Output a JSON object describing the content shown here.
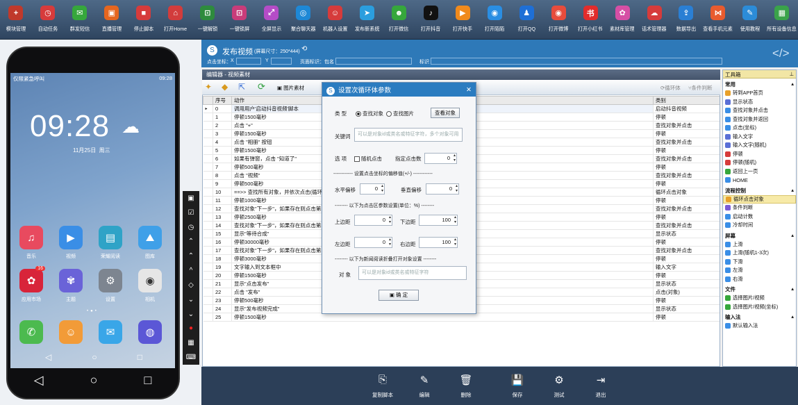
{
  "toolbar": {
    "items": [
      {
        "label": "模块管理",
        "icon": "+",
        "color": "#c0392b"
      },
      {
        "label": "自动任务",
        "icon": "◷",
        "color": "#d63b3b"
      },
      {
        "label": "群发短信",
        "icon": "✉",
        "color": "#36a73c"
      },
      {
        "label": "直播管理",
        "icon": "▣",
        "color": "#e5661f"
      },
      {
        "label": "停止脚本",
        "icon": "■",
        "color": "#d63b3b"
      },
      {
        "label": "打开Home",
        "icon": "⌂",
        "color": "#d23c3c"
      },
      {
        "label": "一键解锁",
        "icon": "⊡",
        "color": "#2e8b3d"
      },
      {
        "label": "一键锁屏",
        "icon": "⊡",
        "color": "#c93c7a"
      },
      {
        "label": "全屏显示",
        "icon": "⤢",
        "color": "#b44cc7"
      },
      {
        "label": "聚合聊天器",
        "icon": "◎",
        "color": "#1e88d6"
      },
      {
        "label": "机器人设置",
        "icon": "☺",
        "color": "#d63b3b"
      },
      {
        "label": "发布新系统",
        "icon": "➤",
        "color": "#2b9ede"
      },
      {
        "label": "打开微信",
        "icon": "☻",
        "color": "#36a73c"
      },
      {
        "label": "打开抖音",
        "icon": "♪",
        "color": "#111111"
      },
      {
        "label": "打开快手",
        "icon": "▶",
        "color": "#f08a1c"
      },
      {
        "label": "打开陌陌",
        "icon": "◉",
        "color": "#2a8ee3"
      },
      {
        "label": "打开QQ",
        "icon": "♟",
        "color": "#1e6fd6"
      },
      {
        "label": "打开微博",
        "icon": "◉",
        "color": "#e74c3c"
      },
      {
        "label": "打开小红书",
        "icon": "书",
        "color": "#e22c2c"
      },
      {
        "label": "素材库管理",
        "icon": "✿",
        "color": "#d64fa5"
      },
      {
        "label": "话术管理器",
        "icon": "☁",
        "color": "#d63b3b"
      },
      {
        "label": "数据导出",
        "icon": "⇪",
        "color": "#2a7fd4"
      },
      {
        "label": "查看手机元素",
        "icon": "⋈",
        "color": "#e85b2e"
      },
      {
        "label": "使用教程",
        "icon": "✎",
        "color": "#2c8cd8"
      },
      {
        "label": "所有设备信息",
        "icon": "▦",
        "color": "#3aa34a"
      }
    ]
  },
  "phone": {
    "status_left": "仅限紧急呼叫",
    "status_right": "09:28",
    "clock": "09:28",
    "date": "11月25日",
    "weekday": "周三",
    "apps_row1": [
      {
        "label": "音乐",
        "icon": "♫",
        "color": "#e84a5f"
      },
      {
        "label": "视频",
        "icon": "▶",
        "color": "#3a8ee6"
      },
      {
        "label": "荣耀阅读",
        "icon": "▤",
        "color": "#2fa3c7"
      },
      {
        "label": "图库",
        "icon": "⛰",
        "color": "#3fa0e8"
      }
    ],
    "apps_row2": [
      {
        "label": "应用市场",
        "icon": "✿",
        "color": "#d8243a",
        "badge": "16"
      },
      {
        "label": "主题",
        "icon": "✾",
        "color": "#6a63d8"
      },
      {
        "label": "设置",
        "icon": "⚙",
        "color": "#7d8590"
      },
      {
        "label": "相机",
        "icon": "◉",
        "color": "#e6e6e6"
      }
    ],
    "dock": [
      {
        "icon": "✆",
        "color": "#4cba4f"
      },
      {
        "icon": "☺",
        "color": "#f29b38"
      },
      {
        "icon": "✉",
        "color": "#39a6e8"
      },
      {
        "icon": "◍",
        "color": "#5b57d6"
      }
    ]
  },
  "window": {
    "title": "发布视频",
    "title_hint": "(屏幕尺寸：250*444)",
    "coord_label": "点击坐标：",
    "x_label": "X",
    "y_label": "Y",
    "page_label": "页面标识：包名",
    "mark_label": "标识",
    "editor_title": "编辑器 - 视频素材",
    "img_material": "图片素材",
    "loop_label": "循环体",
    "cond_label": "条件判断",
    "col_seq": "序号",
    "col_action": "动作",
    "col_type": "类别"
  },
  "rows": [
    {
      "n": "0",
      "a": "调用用户'启动抖音视频'脚本",
      "t": "启动抖音视频"
    },
    {
      "n": "1",
      "a": "停顿1500毫秒",
      "t": "停顿"
    },
    {
      "n": "2",
      "a": "点击 \"+\"",
      "t": "查找对象并点击"
    },
    {
      "n": "3",
      "a": "停顿1500毫秒",
      "t": "停顿"
    },
    {
      "n": "4",
      "a": "点击 \"相册\" 按钮",
      "t": "查找对象并点击"
    },
    {
      "n": "5",
      "a": "停顿1500毫秒",
      "t": "停顿"
    },
    {
      "n": "6",
      "a": "如果有弹窗，点击 \"知道了\"",
      "t": "查找对象并点击"
    },
    {
      "n": "7",
      "a": "停顿500毫秒",
      "t": "停顿"
    },
    {
      "n": "8",
      "a": "点击 \"视频\"",
      "t": "查找对象并点击"
    },
    {
      "n": "9",
      "a": "停顿500毫秒",
      "t": "停顿"
    },
    {
      "n": "10",
      "a": "==>> 查找所有对象，并依次点击(循环)",
      "t": "循环点击对象"
    },
    {
      "n": "11",
      "a": "停顿1000毫秒",
      "t": "停顿"
    },
    {
      "n": "12",
      "a": "查找对象\"下一步\"，如果存在则点击第1个",
      "t": "查找对象并点击"
    },
    {
      "n": "13",
      "a": "停顿2500毫秒",
      "t": "停顿"
    },
    {
      "n": "14",
      "a": "查找对象\"下一步\"，如果存在则点击第1个",
      "t": "查找对象并点击"
    },
    {
      "n": "15",
      "a": "显示\"等待合成\"",
      "t": "显示状态"
    },
    {
      "n": "16",
      "a": "停顿30000毫秒",
      "t": "停顿"
    },
    {
      "n": "17",
      "a": "查找对象\"下一步\"，如果存在则点击第1个",
      "t": "查找对象并点击"
    },
    {
      "n": "18",
      "a": "停顿3000毫秒",
      "t": "停顿"
    },
    {
      "n": "19",
      "a": "文字输入到文本框中",
      "t": "输入文字"
    },
    {
      "n": "20",
      "a": "停顿1500毫秒",
      "t": "停顿"
    },
    {
      "n": "21",
      "a": "显示\"点击发布\"",
      "t": "显示状态"
    },
    {
      "n": "22",
      "a": "点击 \"发布\"",
      "t": "点击(对象)"
    },
    {
      "n": "23",
      "a": "停顿500毫秒",
      "t": "停顿"
    },
    {
      "n": "24",
      "a": "显示\"发布视频完成\"",
      "t": "显示状态"
    },
    {
      "n": "25",
      "a": "停顿1500毫秒",
      "t": "停顿"
    }
  ],
  "dialog": {
    "title": "设置次循环体参数",
    "type_label": "类  型",
    "opt_find_object": "查找对象",
    "opt_find_image": "查找图片",
    "view_object_btn": "查看对象",
    "keyword_label": "关键词",
    "keyword_placeholder": "可以是对象id或类名或特征字符，多个对象可用",
    "options_label": "选  项",
    "random_click": "随机点击",
    "click_count_label": "指定点击数",
    "click_count": "0",
    "offset_caption": "------------ 设置点击坐标的偏移值(+/-) ------------",
    "h_offset_label": "水平偏移",
    "h_offset": "0",
    "v_offset_label": "垂直偏移",
    "v_offset": "0",
    "margin_caption": "-------- 以下为点击区参数设置(单位：%) --------",
    "top_label": "上边距",
    "top": "0",
    "bottom_label": "下边距",
    "bottom": "100",
    "left_label": "左边距",
    "left": "0",
    "right_label": "右边距",
    "right": "100",
    "fold_caption": "-------- 以下为新闻阅读折叠打开对象设置 --------",
    "object_label": "对  象",
    "object_placeholder": "可以是对象id或类名或特征字符",
    "ok_btn": "确  定"
  },
  "toolbox": {
    "title": "工具箱",
    "sections": [
      {
        "name": "常用",
        "items": [
          {
            "label": "转到APP首页",
            "color": "#e8a02a"
          },
          {
            "label": "显示状态",
            "color": "#5a6fd6"
          },
          {
            "label": "查找对象并点击",
            "color": "#3a8ee6"
          },
          {
            "label": "查找对象并返回",
            "color": "#3a8ee6"
          },
          {
            "label": "点击(坐标)",
            "color": "#3a8ee6"
          },
          {
            "label": "输入文字",
            "color": "#5a6fd6"
          },
          {
            "label": "输入文字(随机)",
            "color": "#5a6fd6"
          },
          {
            "label": "停顿",
            "color": "#d63b3b"
          },
          {
            "label": "停顿(随机)",
            "color": "#d63b3b"
          },
          {
            "label": "返回上一页",
            "color": "#36a73c"
          },
          {
            "label": "HOME",
            "color": "#3a8ee6"
          }
        ]
      },
      {
        "name": "流程控制",
        "items": [
          {
            "label": "循环点击对象",
            "color": "#e8a02a",
            "hl": true
          },
          {
            "label": "条件判断",
            "color": "#7a5bd6"
          },
          {
            "label": "启动计数",
            "color": "#3a8ee6"
          },
          {
            "label": "冷却时间",
            "color": "#3a8ee6"
          }
        ]
      },
      {
        "name": "屏幕",
        "items": [
          {
            "label": "上滑",
            "color": "#3a8ee6"
          },
          {
            "label": "上滑(随机1-3次)",
            "color": "#3a8ee6"
          },
          {
            "label": "下滑",
            "color": "#3a8ee6"
          },
          {
            "label": "左滑",
            "color": "#3a8ee6"
          },
          {
            "label": "右滑",
            "color": "#3a8ee6"
          }
        ]
      },
      {
        "name": "文件",
        "items": [
          {
            "label": "选择图片/视频",
            "color": "#36a73c"
          },
          {
            "label": "选择图片/视频(坐标)",
            "color": "#36a73c"
          }
        ]
      },
      {
        "name": "输入法",
        "items": [
          {
            "label": "默认输入法",
            "color": "#3a8ee6"
          }
        ]
      }
    ]
  },
  "bottombar": [
    {
      "label": "复制脚本",
      "icon": "⎘"
    },
    {
      "label": "编辑",
      "icon": "✎"
    },
    {
      "label": "删除",
      "icon": "🗑"
    },
    {
      "label": "保存",
      "icon": "💾"
    },
    {
      "label": "测试",
      "icon": "⚙"
    },
    {
      "label": "退出",
      "icon": "⇥"
    }
  ]
}
